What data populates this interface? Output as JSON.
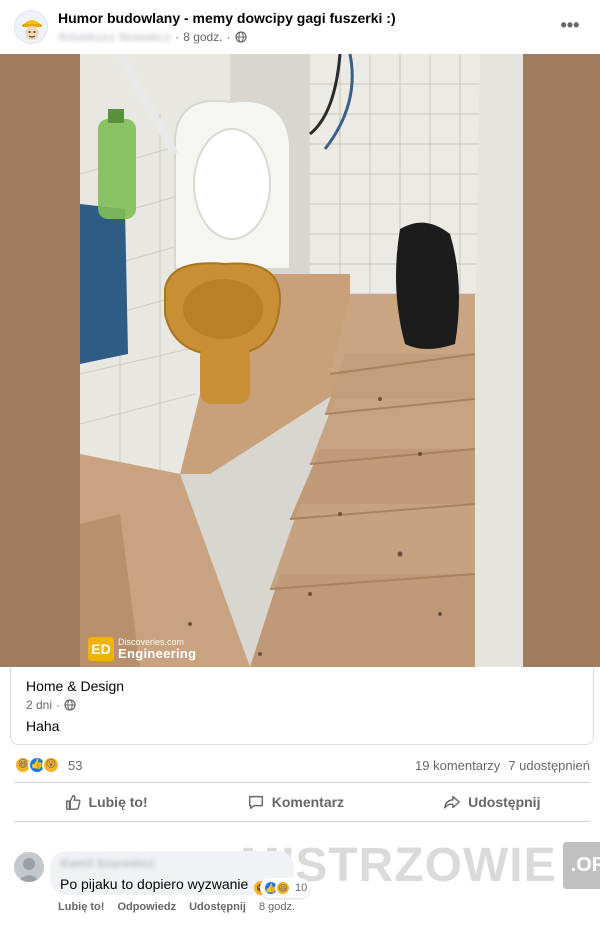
{
  "post": {
    "page_name": "Humor budowlany - memy dowcipy gagi fuszerki :)",
    "author_blurred": "Arkadiusz Nowakcz",
    "time": "8 godz.",
    "separator": "·",
    "privacy_icon": "globe-icon",
    "more_icon": "more-horizontal-icon"
  },
  "photo": {
    "watermark_small": "Discoveries.com",
    "watermark_big": "Engineering",
    "watermark_logo": "ED"
  },
  "shared": {
    "page_name": "Home & Design",
    "time": "2 dni",
    "text": "Haha"
  },
  "stats": {
    "reactions": [
      "haha",
      "like",
      "wow"
    ],
    "reaction_count": "53",
    "comments": "19 komentarzy",
    "shares": "7 udostępnień"
  },
  "actions": {
    "like": "Lubię to!",
    "comment": "Komentarz",
    "share": "Udostępnij"
  },
  "comment": {
    "author_blurred": "Kamil Szarowicz",
    "text": "Po pijaku to dopiero wyzwanie",
    "reaction_count": "10",
    "like": "Lubię to!",
    "reply": "Odpowiedz",
    "share": "Udostępnij",
    "time": "8 godz."
  },
  "site_watermark": {
    "name": "MISTRZOWIE",
    "tld": ".ORG"
  },
  "colors": {
    "link_blue": "#1877f2",
    "secondary_text": "#65676b",
    "photo_bg": "#a07c5f"
  }
}
